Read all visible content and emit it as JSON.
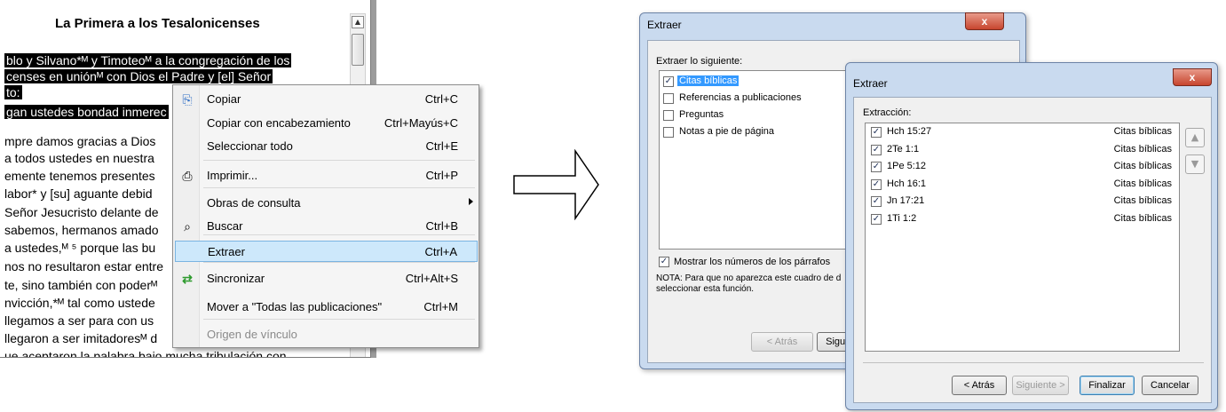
{
  "bible": {
    "title": "La Primera a los Tesalonicenses",
    "lines": [
      "blo y Silvano*ᴹ y Timoteoᴹ a la congregación de los",
      "censes en uniónᴹ con Dios el Padre y [el] Señor",
      "to:",
      "gan ustedes bondad inmerec",
      "mpre damos gracias a Dios",
      "a todos ustedes en nuestra",
      "emente tenemos presentes",
      "labor* y [su] aguante debid",
      "Señor Jesucristo delante de",
      "sabemos, hermanos amado",
      "a ustedes,ᴹ ⁵ porque las bu",
      "nos no resultaron estar entre",
      "te, sino también con poderᴹ",
      "nvicción,*ᴹ tal como ustede",
      "llegamos a ser para con us",
      "llegaron a ser imitadoresᴹ d",
      "ue aceptaron la palabra bajo mucha tribulación con"
    ]
  },
  "context_menu": {
    "items": [
      {
        "label": "Copiar",
        "shortcut": "Ctrl+C",
        "icon": "copy-icon"
      },
      {
        "label": "Copiar con encabezamiento",
        "shortcut": "Ctrl+Mayús+C",
        "icon": ""
      },
      {
        "label": "Seleccionar todo",
        "shortcut": "Ctrl+E",
        "icon": ""
      },
      {
        "label": "Imprimir...",
        "shortcut": "Ctrl+P",
        "icon": "printer-icon"
      },
      {
        "label": "Obras de consulta",
        "shortcut": "",
        "icon": ""
      },
      {
        "label": "Buscar",
        "shortcut": "Ctrl+B",
        "icon": "search-icon"
      },
      {
        "label": "Extraer",
        "shortcut": "Ctrl+A",
        "icon": ""
      },
      {
        "label": "Sincronizar",
        "shortcut": "Ctrl+Alt+S",
        "icon": "sync-icon"
      },
      {
        "label": "Mover a \"Todas las publicaciones\"",
        "shortcut": "Ctrl+M",
        "icon": ""
      },
      {
        "label": "Origen de vínculo",
        "shortcut": "",
        "icon": ""
      }
    ]
  },
  "dialog1": {
    "title": "Extraer",
    "close": "x",
    "section_label": "Extraer lo siguiente:",
    "options": [
      {
        "label": "Citas bíblicas",
        "checked": true
      },
      {
        "label": "Referencias a publicaciones",
        "checked": false
      },
      {
        "label": "Preguntas",
        "checked": false
      },
      {
        "label": "Notas a pie de página",
        "checked": false
      }
    ],
    "show_numbers": "Mostrar los números de los párrafos",
    "note_line1": "NOTA: Para que no aparezca este cuadro de d",
    "note_line2": "seleccionar esta función.",
    "back": "< Atrás",
    "next": "Siguient"
  },
  "dialog2": {
    "title": "Extraer",
    "close": "x",
    "section_label": "Extracción:",
    "rows": [
      {
        "ref": "Hch 15:27",
        "type": "Citas bíblicas"
      },
      {
        "ref": "2Te 1:1",
        "type": "Citas bíblicas"
      },
      {
        "ref": "1Pe 5:12",
        "type": "Citas bíblicas"
      },
      {
        "ref": "Hch 16:1",
        "type": "Citas bíblicas"
      },
      {
        "ref": "Jn 17:21",
        "type": "Citas bíblicas"
      },
      {
        "ref": "1Ti 1:2",
        "type": "Citas bíblicas"
      }
    ],
    "back": "< Atrás",
    "next": "Siguiente >",
    "finish": "Finalizar",
    "cancel": "Cancelar"
  },
  "colors": {
    "selection": "#cde8fb",
    "dialog_frame": "#c9daef",
    "close_button": "#c7452e",
    "sync_green": "#2e9b2e"
  }
}
